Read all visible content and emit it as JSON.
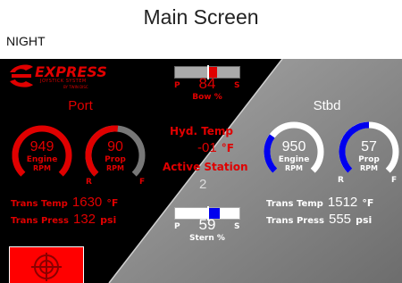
{
  "header": {
    "title": "Main Screen",
    "mode": "NIGHT"
  },
  "logo": {
    "brand": "EXPRESS",
    "tagline": "JOYSTICK SYSTEM",
    "by": "BY TWIN DISC"
  },
  "bow": {
    "value": "84",
    "label": "Bow %",
    "left": "P",
    "right": "S",
    "thrust": 0.55
  },
  "stern": {
    "value": "59",
    "label": "Stern %",
    "left": "P",
    "right": "S",
    "thrust": 0.6
  },
  "hydraulic": {
    "label": "Hyd. Temp",
    "value": "-01",
    "unit": "°F"
  },
  "station": {
    "label": "Active Station",
    "value": "2"
  },
  "port": {
    "title": "Port",
    "engine": {
      "value": "949",
      "label1": "Engine",
      "label2": "RPM",
      "fill": 0.3
    },
    "prop": {
      "value": "90",
      "label1": "Prop",
      "label2": "RPM",
      "left": "R",
      "right": "F",
      "fill": 0.52
    },
    "trans_temp": {
      "label": "Trans Temp",
      "value": "1630",
      "unit": "°F"
    },
    "trans_press": {
      "label": "Trans Press",
      "value": "132",
      "unit": "psi"
    }
  },
  "stbd": {
    "title": "Stbd",
    "engine": {
      "value": "950",
      "label1": "Engine",
      "label2": "RPM",
      "fill": 0.3
    },
    "prop": {
      "value": "57",
      "label1": "Prop",
      "label2": "RPM",
      "left": "R",
      "right": "F",
      "fill": 0.5
    },
    "trans_temp": {
      "label": "Trans Temp",
      "value": "1512",
      "unit": "°F"
    },
    "trans_press": {
      "label": "Trans Press",
      "value": "555",
      "unit": "psi"
    }
  },
  "colors": {
    "night_red": "#e00000",
    "stbd_blue": "#0000ee",
    "panel_black": "#000000",
    "panel_gray": "#8a8a8a"
  }
}
